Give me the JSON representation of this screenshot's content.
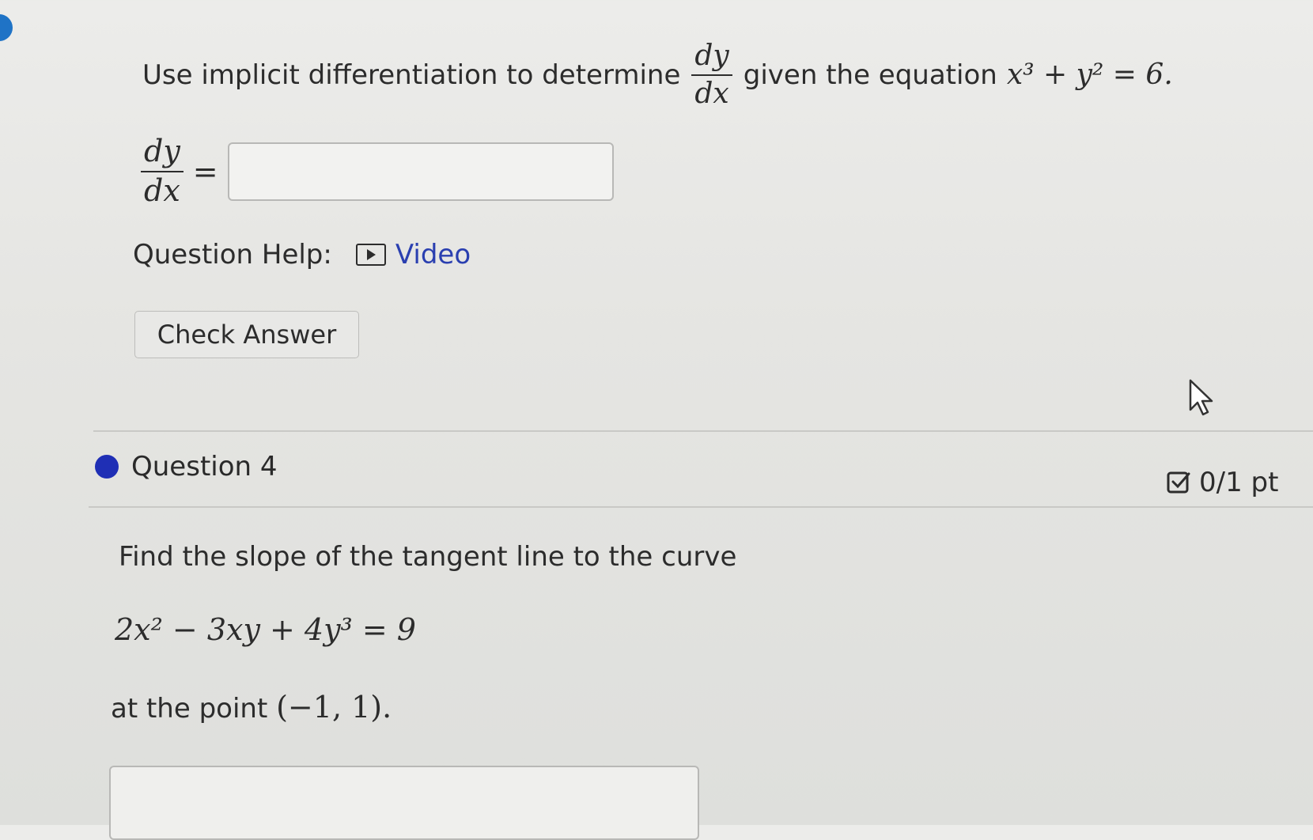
{
  "question3": {
    "prompt_prefix": "Use implicit differentiation to determine",
    "prompt_middle": "given the equation",
    "frac_num": "dy",
    "frac_den": "dx",
    "equation": "x³ + y² = 6.",
    "answer_label_num": "dy",
    "answer_label_den": "dx",
    "equals": "=",
    "answer_value": "",
    "help_label": "Question Help:",
    "video_label": "Video",
    "check_button": "Check Answer"
  },
  "question4": {
    "title": "Question 4",
    "score": "0/1 pt",
    "text1": "Find the slope of the tangent line to the curve",
    "equation": "2x² − 3xy + 4y³ = 9",
    "text2": "at the point",
    "point": "(−1, 1).",
    "answer_value": ""
  },
  "colors": {
    "link": "#2a3fb0",
    "bullet": "#1f2fb5",
    "accent_dot": "#1f73c6"
  }
}
